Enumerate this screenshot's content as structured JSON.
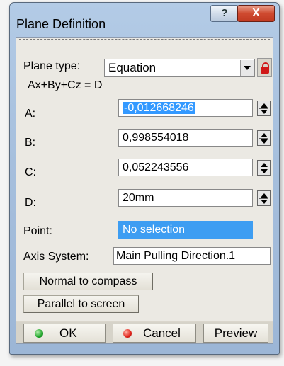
{
  "window": {
    "title": "Plane Definition",
    "help_glyph": "?",
    "close_glyph": "X"
  },
  "plane_type": {
    "label": "Plane type:",
    "value": "Equation"
  },
  "equation": "Ax+By+Cz = D",
  "fields": {
    "a": {
      "label": "A:",
      "value": "-0,012668246"
    },
    "b": {
      "label": "B:",
      "value": "0,998554018"
    },
    "c": {
      "label": "C:",
      "value": "0,052243556"
    },
    "d": {
      "label": "D:",
      "value": "20mm"
    }
  },
  "point": {
    "label": "Point:",
    "value": "No selection"
  },
  "axis_system": {
    "label": "Axis System:",
    "value": "Main Pulling Direction.1"
  },
  "buttons": {
    "normal_to_compass": "Normal to compass",
    "parallel_to_screen": "Parallel to screen",
    "ok": "OK",
    "cancel": "Cancel",
    "preview": "Preview"
  },
  "colors": {
    "selection_blue": "#3d9df2",
    "ok_green": "#1fa52a",
    "cancel_red": "#e2231b",
    "close_red": "#cf4a30"
  },
  "icons": [
    "help-icon",
    "close-icon",
    "lock-icon",
    "dropdown-arrow-icon",
    "spinner-icon",
    "ok-icon",
    "cancel-icon"
  ]
}
